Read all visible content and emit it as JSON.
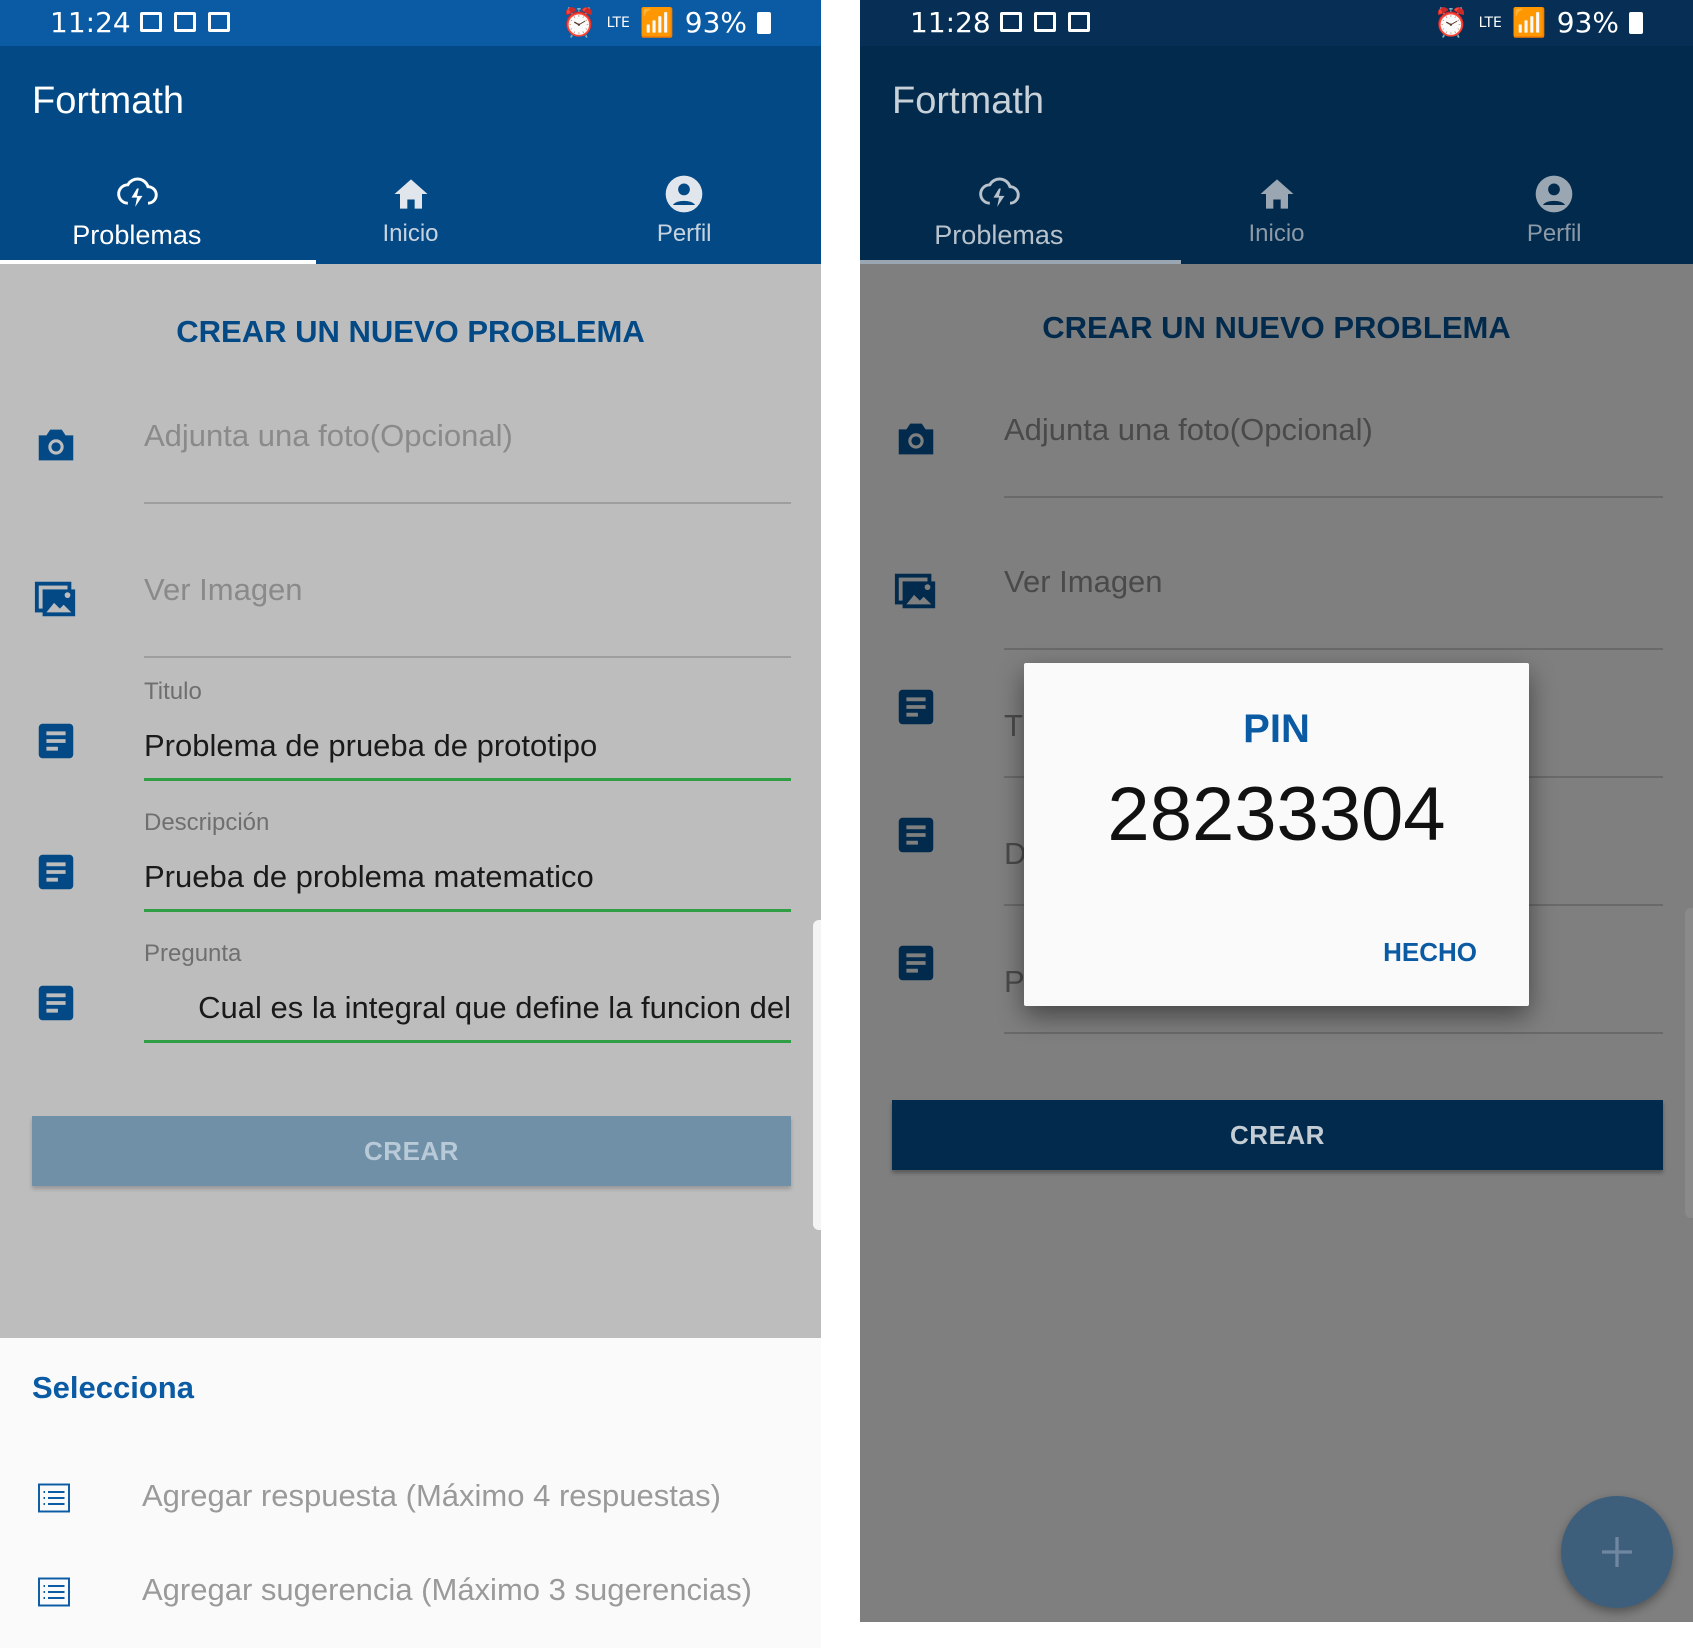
{
  "left": {
    "status": {
      "time": "11:24",
      "battery": "93%",
      "lte": "LTE"
    },
    "app_title": "Fortmath",
    "tabs": [
      {
        "label": "Problemas",
        "icon": "cloud-lightning-icon",
        "active": true
      },
      {
        "label": "Inicio",
        "icon": "home-icon",
        "active": false
      },
      {
        "label": "Perfil",
        "icon": "account-circle-icon",
        "active": false
      }
    ],
    "heading": "CREAR UN NUEVO PROBLEMA",
    "photo_placeholder": "Adjunta una foto(Opcional)",
    "view_image_placeholder": "Ver Imagen",
    "fields": [
      {
        "label": "Titulo",
        "value": "Problema de prueba de prototipo"
      },
      {
        "label": "Descripción",
        "value": "Prueba de problema matematico"
      },
      {
        "label": "Pregunta",
        "value": "Cual es la integral que define la funcion del"
      }
    ],
    "crear_label": "CREAR",
    "sheet": {
      "title": "Selecciona",
      "items": [
        {
          "label": "Agregar respuesta (Máximo 4 respuestas)",
          "icon": "list-icon"
        },
        {
          "label": "Agregar sugerencia (Máximo 3 sugerencias)",
          "icon": "list-icon"
        }
      ]
    }
  },
  "right": {
    "status": {
      "time": "11:28",
      "battery": "93%",
      "lte": "LTE"
    },
    "app_title": "Fortmath",
    "tabs": [
      {
        "label": "Problemas",
        "icon": "cloud-lightning-icon",
        "active": true
      },
      {
        "label": "Inicio",
        "icon": "home-icon",
        "active": false
      },
      {
        "label": "Perfil",
        "icon": "account-circle-icon",
        "active": false
      }
    ],
    "heading": "CREAR UN NUEVO PROBLEMA",
    "photo_placeholder": "Adjunta una foto(Opcional)",
    "view_image_placeholder": "Ver Imagen",
    "partial_labels": {
      "titulo": "T",
      "descripcion": "D",
      "pregunta": "Pregunta"
    },
    "crear_label": "CREAR",
    "dialog": {
      "title": "PIN",
      "pin": "28233304",
      "button": "HECHO"
    }
  },
  "colors": {
    "primary": "#024986",
    "statusbar": "#0a5aa4",
    "accent_green": "#2f9e44",
    "dim_overlay": "#7f7f7f"
  }
}
